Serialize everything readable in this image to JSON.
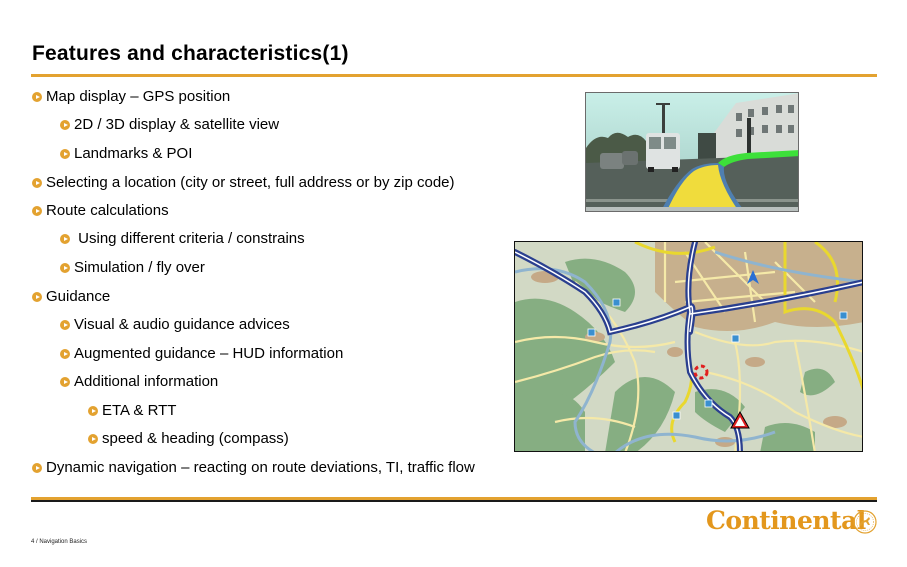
{
  "slide": {
    "title": "Features and characteristics(1)",
    "accent_color": "#e3a230",
    "bullets": [
      {
        "level": 1,
        "text": "Map display – GPS position"
      },
      {
        "level": 2,
        "text": "2D / 3D display & satellite view"
      },
      {
        "level": 2,
        "text": "Landmarks & POI"
      },
      {
        "level": 1,
        "text": "Selecting a location (city or street, full address or by zip code)"
      },
      {
        "level": 1,
        "text": "Route calculations"
      },
      {
        "level": 2,
        "text": " Using different criteria / constrains"
      },
      {
        "level": 2,
        "text": "Simulation / fly over"
      },
      {
        "level": 1,
        "text": "Guidance"
      },
      {
        "level": 2,
        "text": "Visual & audio guidance advices"
      },
      {
        "level": 2,
        "text": "Augmented guidance – HUD information"
      },
      {
        "level": 2,
        "text": "Additional information"
      },
      {
        "level": 3,
        "text": "ETA & RTT"
      },
      {
        "level": 3,
        "text": "speed & heading (compass)"
      },
      {
        "level": 1,
        "text": "Dynamic navigation – reacting on route deviations, TI, traffic flow"
      }
    ],
    "images": {
      "photo": {
        "description": "augmented-reality-street-view",
        "route_color": "#f0dc3c",
        "turn_color": "#3de03a"
      },
      "map": {
        "description": "navigation-map-with-route",
        "route_color": "#2a3f8f"
      }
    },
    "footer": {
      "page_label": "4 / Navigation Basics",
      "logo_text": "Continental"
    }
  }
}
